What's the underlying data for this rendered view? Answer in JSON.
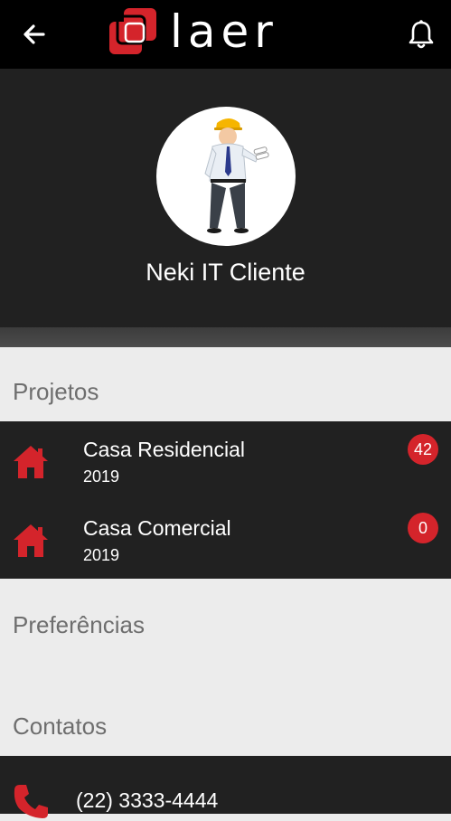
{
  "header": {
    "logo_text": "laer",
    "back_icon": "arrow-back-icon",
    "notification_icon": "bell-icon"
  },
  "profile": {
    "name": "Neki IT Cliente",
    "avatar_icon": "engineer-avatar"
  },
  "sections": {
    "projects_title": "Projetos",
    "preferences_title": "Preferências",
    "contacts_title": "Contatos"
  },
  "projects": [
    {
      "name": "Casa Residencial",
      "year": "2019",
      "badge": "42",
      "icon": "house-icon"
    },
    {
      "name": "Casa Comercial",
      "year": "2019",
      "badge": "0",
      "icon": "house-icon"
    }
  ],
  "contacts": [
    {
      "phone": "(22) 3333-4444",
      "icon": "phone-icon"
    }
  ],
  "colors": {
    "accent": "#d4242b",
    "topbar": "#000000",
    "panel": "#212121",
    "background": "#ececec",
    "section_text": "#6e6e6e"
  }
}
